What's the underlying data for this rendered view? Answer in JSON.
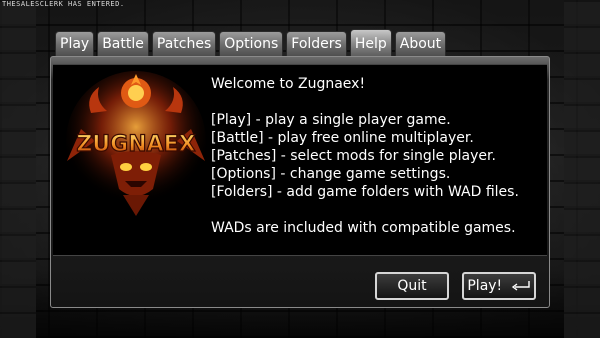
{
  "chat": {
    "message": "THESALESCLERK HAS ENTERED."
  },
  "tabs": [
    {
      "label": "Play"
    },
    {
      "label": "Battle"
    },
    {
      "label": "Patches"
    },
    {
      "label": "Options"
    },
    {
      "label": "Folders"
    },
    {
      "label": "Help",
      "active": true
    },
    {
      "label": "About"
    }
  ],
  "logo": {
    "text": "ZUGNAEX"
  },
  "help": {
    "welcome": "Welcome to Zugnaex!",
    "lines": [
      "[Play] - play a single player game.",
      "[Battle] - play free online multiplayer.",
      "[Patches] - select mods for single player.",
      "[Options] - change game settings.",
      "[Folders] - add game folders with WAD files."
    ],
    "footer": "WADs are included with compatible games."
  },
  "buttons": {
    "quit": "Quit",
    "play": "Play!"
  },
  "colors": {
    "text": "#ffffff",
    "logo_orange": "#e8641a",
    "logo_yellow": "#f4c040"
  }
}
